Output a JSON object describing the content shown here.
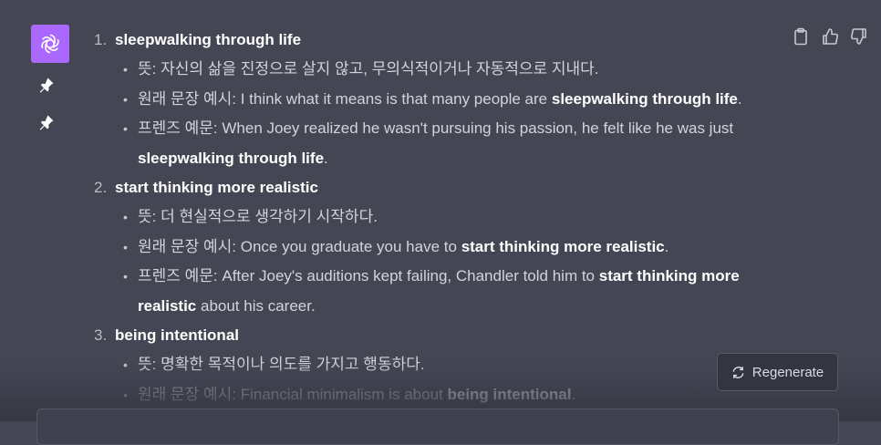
{
  "icons": {
    "assistant_avatar": "openai-logo-icon",
    "pin": "pin-icon",
    "copy": "clipboard-icon",
    "like": "thumbs-up-icon",
    "dislike": "thumbs-down-icon",
    "regenerate": "refresh-icon"
  },
  "colors": {
    "background": "#444654",
    "avatar_bg": "#ab68ff",
    "text": "#d1d5db",
    "emphasis": "#ffffff"
  },
  "items": [
    {
      "num": "1.",
      "term": "sleepwalking through life",
      "meaning": "뜻: 자신의 삶을 진정으로 살지 않고, 무의식적이거나 자동적으로 지내다.",
      "orig_pre": "원래 문장 예시: I think what it means is that many people are ",
      "orig_bold": "sleepwalking through life",
      "orig_post": ".",
      "friends_pre": "프렌즈 예문: When Joey realized he wasn't pursuing his passion, he felt like he was just ",
      "friends_bold": "sleepwalking through life",
      "friends_post": "."
    },
    {
      "num": "2.",
      "term": "start thinking more realistic",
      "meaning": "뜻: 더 현실적으로 생각하기 시작하다.",
      "orig_pre": "원래 문장 예시: Once you graduate you have to ",
      "orig_bold": "start thinking more realistic",
      "orig_post": ".",
      "friends_pre": "프렌즈 예문: After Joey's auditions kept failing, Chandler told him to ",
      "friends_bold": "start thinking more realistic",
      "friends_post": " about his career."
    },
    {
      "num": "3.",
      "term": "being intentional",
      "meaning": "뜻: 명확한 목적이나 의도를 가지고 행동하다.",
      "orig_pre": "원래 문장 예시: Financial minimalism is about ",
      "orig_bold": "being intentional",
      "orig_post": "."
    }
  ],
  "regenerate_label": "Regenerate"
}
